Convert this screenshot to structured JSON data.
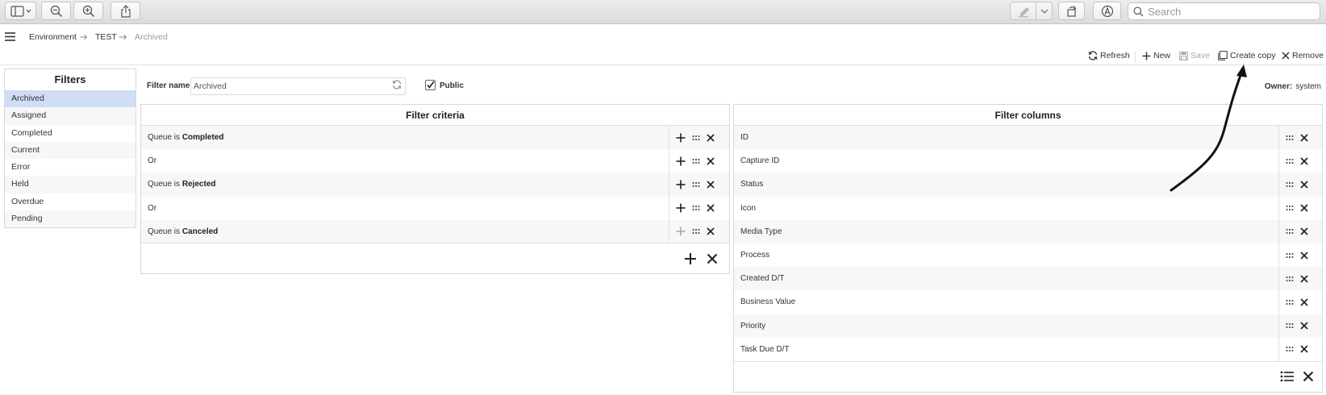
{
  "toolbar": {
    "search_placeholder": "Search"
  },
  "breadcrumb": {
    "items": [
      "Environment",
      "TEST",
      "Archived"
    ]
  },
  "actions": {
    "refresh": "Refresh",
    "new": "New",
    "save": "Save",
    "create_copy": "Create copy",
    "remove": "Remove"
  },
  "filters": {
    "title": "Filters",
    "items": [
      "Archived",
      "Assigned",
      "Completed",
      "Current",
      "Error",
      "Held",
      "Overdue",
      "Pending"
    ],
    "selected": "Archived"
  },
  "form": {
    "filter_name_label": "Filter name",
    "filter_name_value": "Archived",
    "public_label": "Public",
    "public_checked": true,
    "owner_label": "Owner:",
    "owner_value": "system"
  },
  "criteria": {
    "title": "Filter criteria",
    "rows": [
      {
        "prefix": "Queue is ",
        "value": "Completed"
      },
      {
        "prefix": "Or",
        "value": ""
      },
      {
        "prefix": "Queue is ",
        "value": "Rejected"
      },
      {
        "prefix": "Or",
        "value": ""
      },
      {
        "prefix": "Queue is ",
        "value": "Canceled"
      }
    ]
  },
  "columns": {
    "title": "Filter columns",
    "rows": [
      "ID",
      "Capture ID",
      "Status",
      "Icon",
      "Media Type",
      "Process",
      "Created D/T",
      "Business Value",
      "Priority",
      "Task Due D/T"
    ]
  },
  "colors": {
    "selected_bg": "#cfddf6",
    "stripe_bg": "#f7f7f7",
    "disabled_text": "#aaaaaa",
    "annotation": "#111111"
  }
}
